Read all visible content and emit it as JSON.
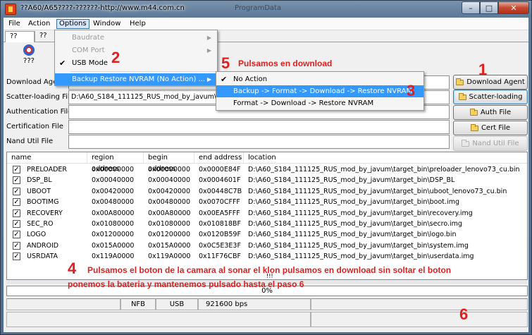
{
  "window": {
    "title": "??A60/A65????-??????-http://www.m44.com.cn",
    "background_title": "ProgramData",
    "minimize": "–",
    "maximize": "□",
    "close": "✕"
  },
  "menubar": [
    "File",
    "Action",
    "Options",
    "Window",
    "Help"
  ],
  "tabs": [
    "??",
    "??"
  ],
  "toolbar": {
    "download_label": "???"
  },
  "file_rows": [
    {
      "label": "Download Agen",
      "value": ""
    },
    {
      "label": "Scatter-loading File",
      "value": "D:\\A60_S184_111125_RUS_mod_by_javum\\tar"
    },
    {
      "label": "Authentication File",
      "value": ""
    },
    {
      "label": "Certification File",
      "value": ""
    },
    {
      "label": "Nand Util File",
      "value": ""
    }
  ],
  "buttons": {
    "download_agent": "Download Agent",
    "scatter_loading": "Scatter-loading",
    "auth_file": "Auth File",
    "cert_file": "Cert File",
    "nand_util_file": "Nand Util File"
  },
  "table": {
    "columns": [
      "name",
      "region address",
      "begin address",
      "end address",
      "location"
    ],
    "rows": [
      {
        "name": "PRELOADER",
        "region": "0x00000000",
        "begin": "0x00000000",
        "end": "0x0000E84F",
        "location": "D:\\A60_S184_111125_RUS_mod_by_javum\\target_bin\\preloader_lenovo73_cu.bin"
      },
      {
        "name": "DSP_BL",
        "region": "0x00040000",
        "begin": "0x00040000",
        "end": "0x0004601F",
        "location": "D:\\A60_S184_111125_RUS_mod_by_javum\\target_bin\\DSP_BL"
      },
      {
        "name": "UBOOT",
        "region": "0x00420000",
        "begin": "0x00420000",
        "end": "0x00448C7B",
        "location": "D:\\A60_S184_111125_RUS_mod_by_javum\\target_bin\\uboot_lenovo73_cu.bin"
      },
      {
        "name": "BOOTIMG",
        "region": "0x00480000",
        "begin": "0x00480000",
        "end": "0x0070CFFF",
        "location": "D:\\A60_S184_111125_RUS_mod_by_javum\\target_bin\\boot.img"
      },
      {
        "name": "RECOVERY",
        "region": "0x00A80000",
        "begin": "0x00A80000",
        "end": "0x00EA5FFF",
        "location": "D:\\A60_S184_111125_RUS_mod_by_javum\\target_bin\\recovery.img"
      },
      {
        "name": "SEC_RO",
        "region": "0x01080000",
        "begin": "0x01080000",
        "end": "0x010818BF",
        "location": "D:\\A60_S184_111125_RUS_mod_by_javum\\target_bin\\secro.img"
      },
      {
        "name": "LOGO",
        "region": "0x01200000",
        "begin": "0x01200000",
        "end": "0x0120B59F",
        "location": "D:\\A60_S184_111125_RUS_mod_by_javum\\target_bin\\logo.bin"
      },
      {
        "name": "ANDROID",
        "region": "0x015A0000",
        "begin": "0x015A0000",
        "end": "0x0C5E3E3F",
        "location": "D:\\A60_S184_111125_RUS_mod_by_javum\\target_bin\\system.img"
      },
      {
        "name": "USRDATA",
        "region": "0x119A0000",
        "begin": "0x119A0000",
        "end": "0x11F76CBF",
        "location": "D:\\A60_S184_111125_RUS_mod_by_javum\\target_bin\\userdata.img"
      }
    ]
  },
  "progress": {
    "text": "0%",
    "fraction": 0
  },
  "scroll_marker": "!!!",
  "statusbar": {
    "nfb": "NFB",
    "usb": "USB",
    "baud": "921600 bps"
  },
  "options_menu": {
    "items": [
      {
        "label": "Baudrate",
        "disabled": true,
        "submenu": true
      },
      {
        "label": "COM Port",
        "disabled": true,
        "submenu": true
      },
      {
        "label": "USB Mode",
        "checked": true
      },
      {
        "label": "Backup Restore NVRAM (No Action) ...",
        "submenu": true,
        "highlighted": true
      }
    ]
  },
  "nvram_submenu": {
    "items": [
      {
        "label": "No Action",
        "checked": true
      },
      {
        "label": "Backup -> Format -> Download -> Restore NVRAM",
        "highlighted": true
      },
      {
        "label": "Format -> Download -> Restore NVRAM"
      }
    ]
  },
  "annotations": {
    "n1": "1",
    "n2": "2",
    "n3": "3",
    "n4": "4",
    "n5": "5",
    "n6": "6",
    "step5_text": "Pulsamos en download",
    "step4_line1": "Pulsamos el boton de la camara al sonar el klon pulsamos en download sin soltar el boton",
    "step4_line2": "ponemos la bateria y mantenemos pulsado hasta el paso 6",
    "color": "#e02020"
  },
  "colors": {
    "highlight": "#3399ff",
    "title_bar": "#5d7a99",
    "close_button": "#c74a32"
  }
}
